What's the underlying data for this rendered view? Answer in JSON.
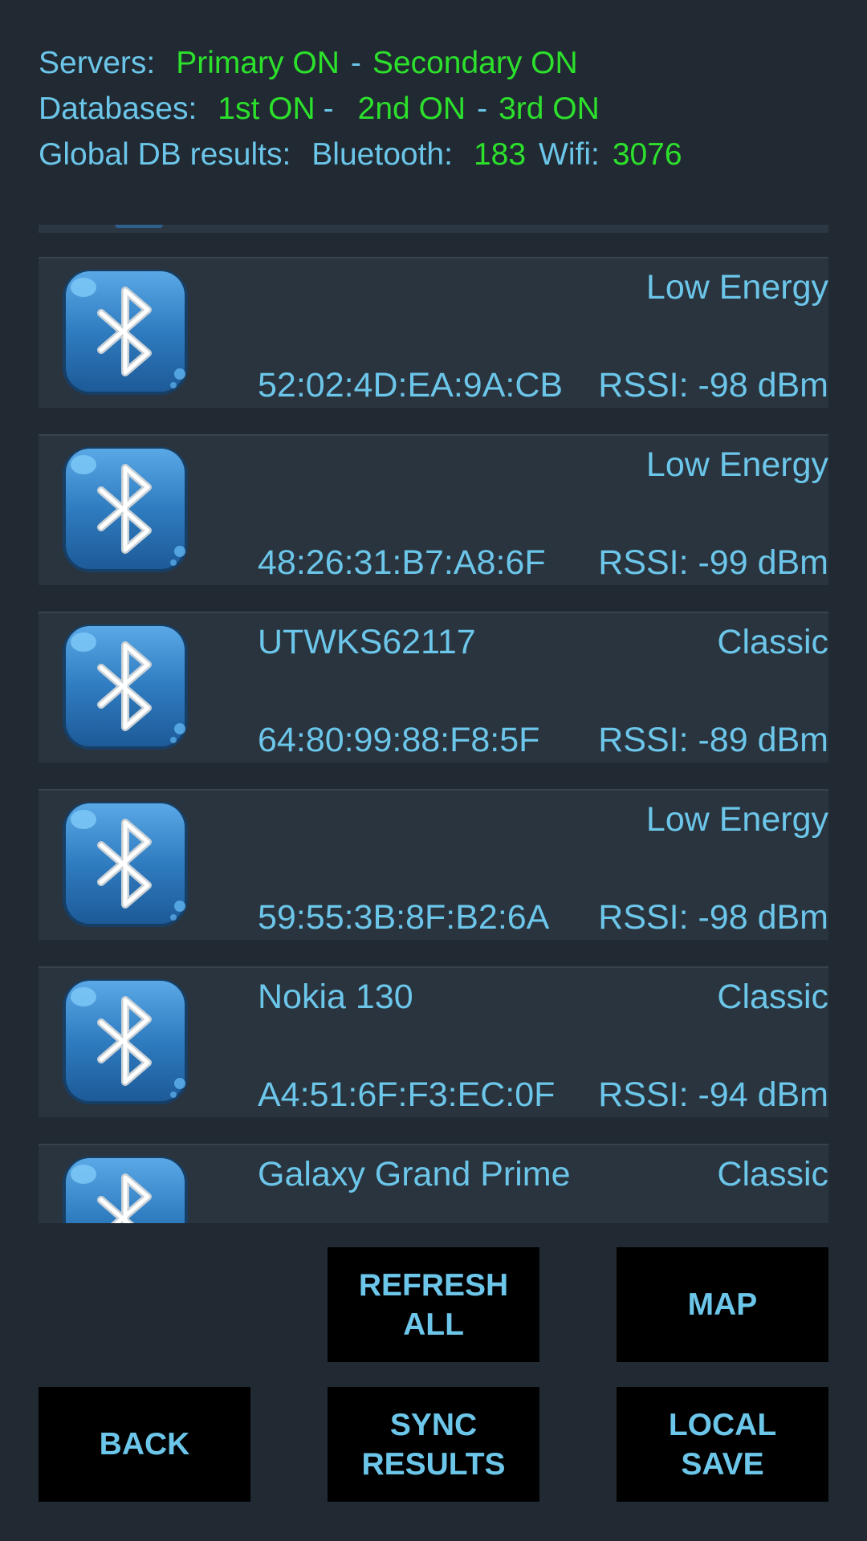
{
  "status": {
    "servers_label": "Servers:",
    "primary": "Primary ON",
    "dash1": "-",
    "secondary": "Secondary ON",
    "databases_label": "Databases:",
    "db1": "1st ON",
    "dash2": "-",
    "db2": "2nd ON",
    "dash3": "-",
    "db3": "3rd ON",
    "global_label": "Global DB results:",
    "bluetooth_label": "Bluetooth:",
    "bluetooth_count": "183",
    "wifi_label": "Wifi:",
    "wifi_count": "3076"
  },
  "devices": [
    {
      "name": "",
      "type": "Low Energy",
      "mac": "52:02:4D:EA:9A:CB",
      "rssi": "RSSI: -98 dBm",
      "icon": "bluetooth-icon"
    },
    {
      "name": "",
      "type": "Low Energy",
      "mac": "48:26:31:B7:A8:6F",
      "rssi": "RSSI: -99 dBm",
      "icon": "bluetooth-icon"
    },
    {
      "name": "UTWKS62117",
      "type": "Classic",
      "mac": "64:80:99:88:F8:5F",
      "rssi": "RSSI: -89 dBm",
      "icon": "bluetooth-icon"
    },
    {
      "name": "",
      "type": "Low Energy",
      "mac": "59:55:3B:8F:B2:6A",
      "rssi": "RSSI: -98 dBm",
      "icon": "bluetooth-icon"
    },
    {
      "name": "Nokia 130",
      "type": "Classic",
      "mac": "A4:51:6F:F3:EC:0F",
      "rssi": "RSSI: -94 dBm",
      "icon": "bluetooth-icon"
    },
    {
      "name": "Galaxy Grand Prime",
      "type": "Classic",
      "mac": "",
      "rssi": "",
      "icon": "bluetooth-icon"
    }
  ],
  "buttons": {
    "refresh_all": "REFRESH\nALL",
    "map": "MAP",
    "back": "BACK",
    "sync_results": "SYNC\nRESULTS",
    "local_save": "LOCAL\nSAVE"
  },
  "colors": {
    "background": "#212a32",
    "text_blue": "#6cc6ea",
    "status_green": "#2ce02c",
    "row_background": "#29343e",
    "button_background": "#000000"
  }
}
